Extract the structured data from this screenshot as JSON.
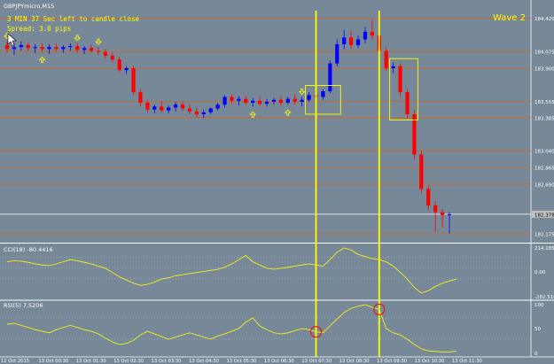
{
  "window": {
    "title": "GBPJPYmicro,M15"
  },
  "overlay": {
    "timer_text": "3 MIN 37 Sec left to candle close",
    "spread_text": "Spread: 3.0 pips",
    "wave_label": "Wave 2"
  },
  "colors": {
    "background": "#778899",
    "bull_candle": "#0000ff",
    "bear_candle": "#ff0000",
    "level_line": "#d2691e",
    "indicator_line": "#ffff00",
    "highlight": "#ffff00",
    "signal_circle": "#ff0000",
    "current_price_line": "#ffffff"
  },
  "chart_data": [
    {
      "type": "candlestick",
      "name": "GBPJPYmicro,M15",
      "price_axis_ticks": [
        "184.420",
        "184.075",
        "183.900",
        "183.555",
        "183.385",
        "183.040",
        "182.865",
        "182.690",
        "182.378",
        "182.175"
      ],
      "price_levels_marked": [
        184.42,
        184.075,
        183.9,
        183.555,
        183.385,
        183.04,
        182.865,
        182.69,
        182.378,
        182.175
      ],
      "current_price": 182.378,
      "ylim": [
        182.1,
        184.5
      ],
      "time_ticks": [
        "12 Oct 2015",
        "13 Oct 00:30",
        "13 Oct 01:30",
        "13 Oct 02:30",
        "13 Oct 03:30",
        "13 Oct 04:30",
        "13 Oct 05:30",
        "13 Oct 06:30",
        "13 Oct 07:30",
        "13 Oct 08:30",
        "13 Oct 09:30",
        "13 Oct 10:30",
        "13 Oct 11:30"
      ],
      "candles": [
        {
          "o": 184.14,
          "h": 184.18,
          "l": 184.06,
          "c": 184.1
        },
        {
          "o": 184.1,
          "h": 184.16,
          "l": 184.04,
          "c": 184.12
        },
        {
          "o": 184.12,
          "h": 184.18,
          "l": 184.08,
          "c": 184.14
        },
        {
          "o": 184.14,
          "h": 184.17,
          "l": 184.08,
          "c": 184.11
        },
        {
          "o": 184.11,
          "h": 184.15,
          "l": 184.06,
          "c": 184.12
        },
        {
          "o": 184.12,
          "h": 184.16,
          "l": 184.07,
          "c": 184.1
        },
        {
          "o": 184.1,
          "h": 184.15,
          "l": 184.05,
          "c": 184.12
        },
        {
          "o": 184.12,
          "h": 184.16,
          "l": 184.08,
          "c": 184.1
        },
        {
          "o": 184.1,
          "h": 184.14,
          "l": 184.06,
          "c": 184.12
        },
        {
          "o": 184.12,
          "h": 184.16,
          "l": 184.08,
          "c": 184.13
        },
        {
          "o": 184.13,
          "h": 184.16,
          "l": 184.06,
          "c": 184.09
        },
        {
          "o": 184.09,
          "h": 184.13,
          "l": 184.05,
          "c": 184.11
        },
        {
          "o": 184.11,
          "h": 184.14,
          "l": 184.06,
          "c": 184.08
        },
        {
          "o": 184.08,
          "h": 184.12,
          "l": 184.04,
          "c": 184.07
        },
        {
          "o": 184.07,
          "h": 184.1,
          "l": 184.0,
          "c": 184.03
        },
        {
          "o": 184.03,
          "h": 184.06,
          "l": 183.96,
          "c": 183.99
        },
        {
          "o": 183.99,
          "h": 184.02,
          "l": 183.86,
          "c": 183.88
        },
        {
          "o": 183.88,
          "h": 183.92,
          "l": 183.84,
          "c": 183.9
        },
        {
          "o": 183.9,
          "h": 183.92,
          "l": 183.62,
          "c": 183.65
        },
        {
          "o": 183.65,
          "h": 183.68,
          "l": 183.5,
          "c": 183.54
        },
        {
          "o": 183.54,
          "h": 183.57,
          "l": 183.44,
          "c": 183.47
        },
        {
          "o": 183.47,
          "h": 183.52,
          "l": 183.43,
          "c": 183.5
        },
        {
          "o": 183.5,
          "h": 183.56,
          "l": 183.44,
          "c": 183.46
        },
        {
          "o": 183.46,
          "h": 183.51,
          "l": 183.43,
          "c": 183.49
        },
        {
          "o": 183.49,
          "h": 183.55,
          "l": 183.45,
          "c": 183.52
        },
        {
          "o": 183.52,
          "h": 183.56,
          "l": 183.45,
          "c": 183.48
        },
        {
          "o": 183.48,
          "h": 183.52,
          "l": 183.42,
          "c": 183.45
        },
        {
          "o": 183.45,
          "h": 183.49,
          "l": 183.39,
          "c": 183.42
        },
        {
          "o": 183.42,
          "h": 183.47,
          "l": 183.38,
          "c": 183.44
        },
        {
          "o": 183.44,
          "h": 183.49,
          "l": 183.42,
          "c": 183.48
        },
        {
          "o": 183.48,
          "h": 183.54,
          "l": 183.46,
          "c": 183.52
        },
        {
          "o": 183.52,
          "h": 183.62,
          "l": 183.49,
          "c": 183.6
        },
        {
          "o": 183.6,
          "h": 183.63,
          "l": 183.53,
          "c": 183.56
        },
        {
          "o": 183.56,
          "h": 183.61,
          "l": 183.51,
          "c": 183.58
        },
        {
          "o": 183.58,
          "h": 183.61,
          "l": 183.52,
          "c": 183.54
        },
        {
          "o": 183.54,
          "h": 183.59,
          "l": 183.5,
          "c": 183.56
        },
        {
          "o": 183.56,
          "h": 183.6,
          "l": 183.51,
          "c": 183.53
        },
        {
          "o": 183.53,
          "h": 183.58,
          "l": 183.5,
          "c": 183.55
        },
        {
          "o": 183.55,
          "h": 183.59,
          "l": 183.52,
          "c": 183.57
        },
        {
          "o": 183.57,
          "h": 183.6,
          "l": 183.51,
          "c": 183.54
        },
        {
          "o": 183.54,
          "h": 183.6,
          "l": 183.52,
          "c": 183.58
        },
        {
          "o": 183.58,
          "h": 183.63,
          "l": 183.52,
          "c": 183.55
        },
        {
          "o": 183.55,
          "h": 183.6,
          "l": 183.5,
          "c": 183.57
        },
        {
          "o": 183.57,
          "h": 183.65,
          "l": 183.55,
          "c": 183.62
        },
        {
          "o": 183.62,
          "h": 183.66,
          "l": 183.57,
          "c": 183.6
        },
        {
          "o": 183.6,
          "h": 183.68,
          "l": 183.57,
          "c": 183.66
        },
        {
          "o": 183.66,
          "h": 183.98,
          "l": 183.64,
          "c": 183.95
        },
        {
          "o": 183.95,
          "h": 184.2,
          "l": 183.92,
          "c": 184.15
        },
        {
          "o": 184.15,
          "h": 184.3,
          "l": 184.1,
          "c": 184.22
        },
        {
          "o": 184.22,
          "h": 184.29,
          "l": 184.1,
          "c": 184.14
        },
        {
          "o": 184.14,
          "h": 184.24,
          "l": 184.11,
          "c": 184.2
        },
        {
          "o": 184.2,
          "h": 184.33,
          "l": 184.16,
          "c": 184.28
        },
        {
          "o": 184.28,
          "h": 184.4,
          "l": 184.2,
          "c": 184.24
        },
        {
          "o": 184.24,
          "h": 184.26,
          "l": 184.04,
          "c": 184.08
        },
        {
          "o": 184.08,
          "h": 184.12,
          "l": 183.87,
          "c": 183.9
        },
        {
          "o": 183.9,
          "h": 183.96,
          "l": 183.85,
          "c": 183.92
        },
        {
          "o": 183.92,
          "h": 183.95,
          "l": 183.6,
          "c": 183.65
        },
        {
          "o": 183.65,
          "h": 183.68,
          "l": 183.38,
          "c": 183.42
        },
        {
          "o": 183.42,
          "h": 183.46,
          "l": 182.95,
          "c": 183.0
        },
        {
          "o": 183.0,
          "h": 183.04,
          "l": 182.6,
          "c": 182.64
        },
        {
          "o": 182.64,
          "h": 182.68,
          "l": 182.42,
          "c": 182.47
        },
        {
          "o": 182.47,
          "h": 182.52,
          "l": 182.2,
          "c": 182.4
        },
        {
          "o": 182.4,
          "h": 182.43,
          "l": 182.24,
          "c": 182.37
        },
        {
          "o": 182.37,
          "h": 182.4,
          "l": 182.18,
          "c": 182.378
        }
      ],
      "arrows": [
        {
          "index": 0,
          "dir": "down"
        },
        {
          "index": 5,
          "dir": "up"
        },
        {
          "index": 10,
          "dir": "down"
        },
        {
          "index": 13,
          "dir": "down"
        },
        {
          "index": 35,
          "dir": "up"
        },
        {
          "index": 40,
          "dir": "up"
        },
        {
          "index": 42,
          "dir": "down"
        }
      ],
      "vertical_markers": [
        {
          "index": 44
        },
        {
          "index": 53
        }
      ],
      "highlight_boxes": [
        {
          "from_index": 43,
          "to_index": 47,
          "top": 183.72,
          "bottom": 183.42
        },
        {
          "from_index": 55,
          "to_index": 58,
          "top": 184.0,
          "bottom": 183.36
        }
      ],
      "wave_label": "Wave 2"
    },
    {
      "type": "line",
      "name": "CCI(18)",
      "label": "CCI(18) -80.4416",
      "value_labels": [
        "214.1858",
        "0.00",
        "-282.5109"
      ],
      "ylim": [
        -282.5109,
        214.1858
      ],
      "levels": [
        100,
        0,
        -100
      ],
      "values": [
        60,
        70,
        65,
        55,
        40,
        30,
        25,
        40,
        60,
        80,
        70,
        55,
        40,
        20,
        0,
        -40,
        -80,
        -110,
        -140,
        -160,
        -150,
        -130,
        -100,
        -90,
        -70,
        -60,
        -50,
        -40,
        -30,
        -20,
        -10,
        10,
        40,
        80,
        120,
        60,
        30,
        0,
        -10,
        0,
        10,
        20,
        30,
        40,
        30,
        20,
        80,
        150,
        190,
        170,
        130,
        110,
        90,
        80,
        60,
        20,
        -40,
        -100,
        -180,
        -230,
        -210,
        -170,
        -140,
        -120,
        -100
      ]
    },
    {
      "type": "line",
      "name": "RSI(5)",
      "label": "RSI(5) 7.5206",
      "value_labels": [
        "100",
        "50",
        "0"
      ],
      "ylim": [
        0,
        100
      ],
      "levels": [
        70,
        30
      ],
      "values": [
        58,
        60,
        56,
        52,
        48,
        45,
        42,
        48,
        52,
        56,
        52,
        48,
        45,
        40,
        32,
        25,
        20,
        22,
        28,
        38,
        45,
        40,
        35,
        30,
        34,
        38,
        42,
        38,
        34,
        30,
        36,
        40,
        45,
        50,
        62,
        70,
        55,
        48,
        42,
        40,
        42,
        46,
        50,
        48,
        44,
        42,
        55,
        68,
        80,
        88,
        92,
        95,
        90,
        86,
        50,
        42,
        38,
        30,
        20,
        12,
        8,
        7,
        6,
        6,
        7.5
      ]
    }
  ]
}
